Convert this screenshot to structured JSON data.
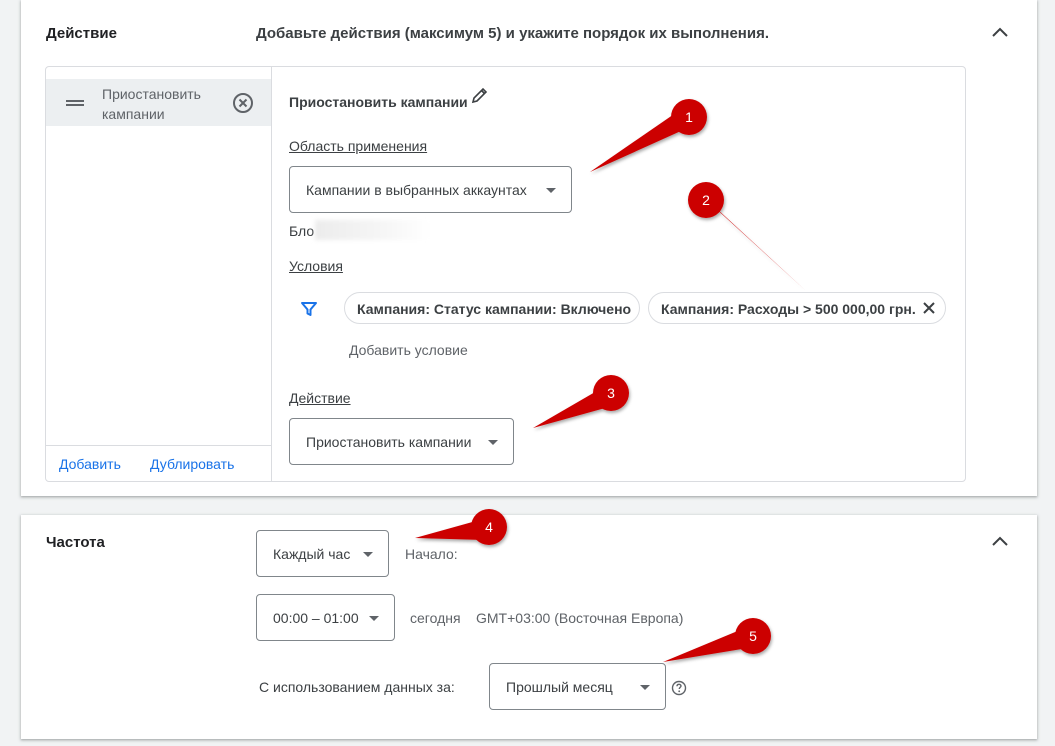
{
  "action_section": {
    "label": "Действие",
    "description": "Добавьте действия (максимум 5) и укажите порядок их выполнения.",
    "list_items": [
      {
        "label": "Приостановить кампании"
      }
    ],
    "add_link": "Добавить",
    "duplicate_link": "Дублировать",
    "rule": {
      "title": "Приостановить кампании",
      "scope_label": "Область применения",
      "scope_value": "Кампании в выбранных аккаунтах",
      "accounts_text_partial": "Бло",
      "conditions_label": "Условия",
      "conditions": [
        {
          "text": "Кампания: Статус кампании: Включено"
        },
        {
          "text": "Кампания: Расходы > 500 000,00 грн."
        }
      ],
      "add_condition": "Добавить условие",
      "action_label": "Действие",
      "action_value": "Приостановить кампании"
    }
  },
  "frequency_section": {
    "label": "Частота",
    "frequency_value": "Каждый час",
    "start_label": "Начало:",
    "time_value": "00:00 – 01:00",
    "today_text": "сегодня",
    "timezone_text": "GMT+03:00 (Восточная Европа)",
    "data_label": "С использованием данных за:",
    "data_value": "Прошлый месяц"
  },
  "annotations": {
    "markers": [
      "1",
      "2",
      "3",
      "4",
      "5"
    ],
    "color": "#cc0000"
  },
  "icons": {
    "collapse": "chevron-up-icon",
    "edit": "pencil-icon",
    "remove": "remove-circle-icon",
    "drag": "drag-handle-icon",
    "filter": "filter-icon",
    "chip_remove": "close-icon",
    "help": "help-circle-icon"
  },
  "colors": {
    "accent": "#1a73e8",
    "text": "#3c4043",
    "secondary": "#5f6368",
    "background": "#f1f3f4"
  }
}
